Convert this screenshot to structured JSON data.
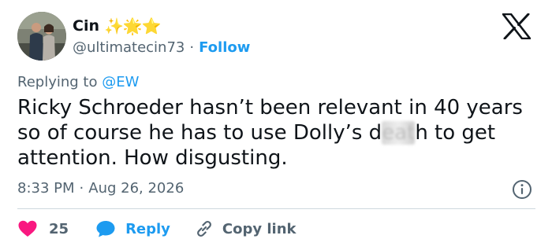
{
  "user": {
    "display_name": "Cin",
    "emoji": "✨🌟⭐",
    "handle": "@ultimatecin73",
    "separator": "·",
    "follow_label": "Follow"
  },
  "reply_context": {
    "prefix": "Replying to ",
    "mention": "@EW"
  },
  "tweet": {
    "text_before": "Ricky Schroeder hasn’t been relevant in 40 years so of course he has to use Dolly’s d",
    "censored": "eat",
    "text_after": "h to get attention. How disgusting."
  },
  "meta": {
    "time": "8:33 PM",
    "separator": "·",
    "date": "Aug 26, 2026"
  },
  "actions": {
    "like_count": "25",
    "reply_label": "Reply",
    "copy_label": "Copy link"
  },
  "colors": {
    "accent": "#1d9bf0",
    "like": "#f91880",
    "secondary_text": "#536471",
    "divider": "#cfd9de"
  },
  "icons": [
    "x-logo-icon",
    "info-icon",
    "heart-icon",
    "reply-bubble-icon",
    "link-icon"
  ]
}
